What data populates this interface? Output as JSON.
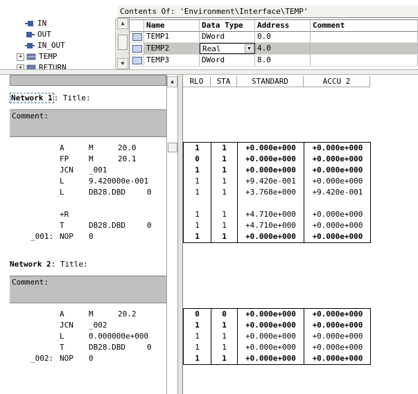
{
  "tree": {
    "items": [
      {
        "label": "IN",
        "icon": "interface-in-icon"
      },
      {
        "label": "OUT",
        "icon": "interface-out-icon"
      },
      {
        "label": "IN_OUT",
        "icon": "interface-inout-icon"
      },
      {
        "label": "TEMP",
        "icon": "interface-temp-icon",
        "expander": "+"
      },
      {
        "label": "RETURN",
        "icon": "interface-return-icon",
        "expander": "+"
      }
    ]
  },
  "contents": {
    "header": "Contents Of: 'Environment\\Interface\\TEMP'",
    "columns": [
      "Name",
      "Data Type",
      "Address",
      "Comment"
    ],
    "rows": [
      {
        "name": "TEMP1",
        "type": "DWord",
        "address": "0.0",
        "comment": ""
      },
      {
        "name": "TEMP2",
        "type": "Real",
        "address": "4.0",
        "comment": "",
        "selected": true
      },
      {
        "name": "TEMP3",
        "type": "DWord",
        "address": "8.0",
        "comment": ""
      }
    ]
  },
  "networks": [
    {
      "label": "Network 1",
      "title_suffix": ": Title:",
      "comment_label": "Comment:",
      "lines": [
        {
          "label": "",
          "op": "A",
          "operand": "M",
          "value": "20.0",
          "extra": ""
        },
        {
          "label": "",
          "op": "FP",
          "operand": "M",
          "value": "20.1",
          "extra": ""
        },
        {
          "label": "",
          "op": "JCN",
          "operand": "_001",
          "value": "",
          "extra": ""
        },
        {
          "label": "",
          "op": "L",
          "operand": "9.420000e-001",
          "value": "",
          "extra": ""
        },
        {
          "label": "",
          "op": "L",
          "operand": "DB28.DBD",
          "value": "",
          "extra": "0"
        },
        {
          "label": "",
          "op": "",
          "operand": "",
          "value": "",
          "extra": ""
        },
        {
          "label": "",
          "op": "+R",
          "operand": "",
          "value": "",
          "extra": ""
        },
        {
          "label": "",
          "op": "T",
          "operand": "DB28.DBD",
          "value": "",
          "extra": "0"
        },
        {
          "label": "_001:",
          "op": "NOP",
          "operand": "0",
          "value": "",
          "extra": ""
        }
      ],
      "status": [
        {
          "rlo": "1",
          "sta": "1",
          "standard": "+0.000e+000",
          "accu2": "+0.000e+000",
          "bold": true
        },
        {
          "rlo": "0",
          "sta": "1",
          "standard": "+0.000e+000",
          "accu2": "+0.000e+000",
          "bold": true
        },
        {
          "rlo": "1",
          "sta": "1",
          "standard": "+0.000e+000",
          "accu2": "+0.000e+000",
          "bold": true
        },
        {
          "rlo": "1",
          "sta": "1",
          "standard": "+9.420e-001",
          "accu2": "+0.000e+000",
          "bold": false
        },
        {
          "rlo": "1",
          "sta": "1",
          "standard": "+3.768e+000",
          "accu2": "+9.420e-001",
          "bold": false
        },
        {
          "rlo": "",
          "sta": "",
          "standard": "",
          "accu2": "",
          "bold": false
        },
        {
          "rlo": "1",
          "sta": "1",
          "standard": "+4.710e+000",
          "accu2": "+0.000e+000",
          "bold": false
        },
        {
          "rlo": "1",
          "sta": "1",
          "standard": "+4.710e+000",
          "accu2": "+0.000e+000",
          "bold": false
        },
        {
          "rlo": "1",
          "sta": "1",
          "standard": "+0.000e+000",
          "accu2": "+0.000e+000",
          "bold": true
        }
      ]
    },
    {
      "label": "Network 2",
      "title_suffix": ": Title:",
      "comment_label": "Comment:",
      "lines": [
        {
          "label": "",
          "op": "A",
          "operand": "M",
          "value": "20.2",
          "extra": ""
        },
        {
          "label": "",
          "op": "JCN",
          "operand": "_002",
          "value": "",
          "extra": ""
        },
        {
          "label": "",
          "op": "L",
          "operand": "0.000000e+000",
          "value": "",
          "extra": ""
        },
        {
          "label": "",
          "op": "T",
          "operand": "DB28.DBD",
          "value": "",
          "extra": "0"
        },
        {
          "label": "_002:",
          "op": "NOP",
          "operand": "0",
          "value": "",
          "extra": ""
        }
      ],
      "status": [
        {
          "rlo": "0",
          "sta": "0",
          "standard": "+0.000e+000",
          "accu2": "+0.000e+000",
          "bold": true
        },
        {
          "rlo": "1",
          "sta": "1",
          "standard": "+0.000e+000",
          "accu2": "+0.000e+000",
          "bold": true
        },
        {
          "rlo": "1",
          "sta": "1",
          "standard": "+0.000e+000",
          "accu2": "+0.000e+000",
          "bold": false
        },
        {
          "rlo": "1",
          "sta": "1",
          "standard": "+0.000e+000",
          "accu2": "+0.000e+000",
          "bold": false
        },
        {
          "rlo": "1",
          "sta": "1",
          "standard": "+0.000e+000",
          "accu2": "+0.000e+000",
          "bold": true
        }
      ]
    }
  ],
  "status_headers": [
    "RLO",
    "STA",
    "STANDARD",
    "ACCU 2"
  ],
  "colors": {
    "selected_row": "#c8c7c2",
    "comment_bg": "#c0c0c0",
    "network_box": "#2a6e8c"
  }
}
